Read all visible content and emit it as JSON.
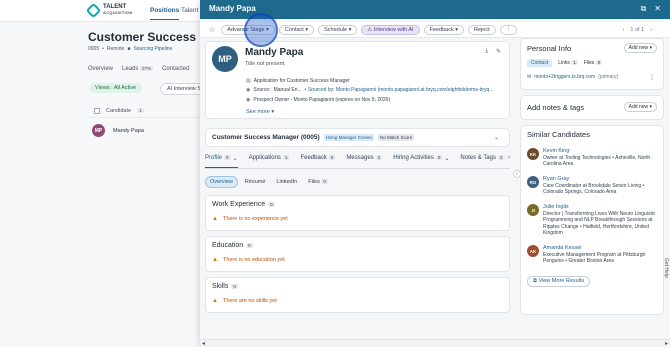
{
  "bg": {
    "logo_line1": "TALENT",
    "logo_line2": "ACQUISITION",
    "nav": [
      "Positions",
      "Talent"
    ],
    "title": "Customer Success Mc",
    "sub_id": "0005",
    "sub_sep1": "•",
    "sub_location": "Remote",
    "sub_sep2": "■",
    "sub_pipeline": "Sourcing Pipeline",
    "tabs": [
      {
        "label": "Overview",
        "count": ""
      },
      {
        "label": "Leads",
        "count": "27%"
      },
      {
        "label": "Contacted",
        "count": ""
      }
    ],
    "views_label": "Views : All Active",
    "ai_label": "AI Interview S",
    "table_header": "Candidate",
    "table_header_count": "1",
    "row_initials": "MP",
    "row_name": "Mandy Papa"
  },
  "drawer": {
    "title": "Mandy Papa",
    "head_icons": [
      "external-link",
      "close"
    ],
    "toolbar": {
      "advance_stage": "Advance Stage ▾",
      "contact": "Contact ▾",
      "schedule": "Schedule ▾",
      "interview_ai": "⚠ Interview with AI",
      "feedback": "Feedback ▾",
      "reject": "Reject",
      "more": "⋮",
      "pager": "1 of 1"
    },
    "profile": {
      "initials": "MP",
      "name": "Mandy Papa",
      "title": "Title not present.",
      "application": "Application for Customer Success Manager",
      "source_label": "Source:",
      "source_value": "Manual En...",
      "sourced_by": "• Sourced by: Monto Papagianni (monto.papagianni.at.bryq.com/eighttolderms-bryq...",
      "owner": "Prospect Owner - Monto Papagianni (expires on Nov 9, 2026)",
      "see_more": "See more ▾"
    },
    "job": {
      "title": "Customer Success Manager (0005)",
      "badge_screen": "Hiring Manager Screen",
      "badge_score": "No Match Score"
    },
    "tabs": [
      {
        "label": "Profile",
        "count": "0",
        "active": true
      },
      {
        "label": "Applications",
        "count": "1"
      },
      {
        "label": "Feedback",
        "count": "0"
      },
      {
        "label": "Messages",
        "count": "2"
      },
      {
        "label": "Hiring Activities",
        "count": "0"
      },
      {
        "label": "Notes & Tags",
        "count": "2"
      }
    ],
    "sub_tabs": [
      "Overview",
      "Résumé",
      "LinkedIn",
      "Files"
    ],
    "sub_tabs_files_count": "0",
    "sections": [
      {
        "title": "Work Experience",
        "count": "0",
        "empty": "There is no experience yet"
      },
      {
        "title": "Education",
        "count": "0",
        "empty": "There is no education yet"
      },
      {
        "title": "Skills",
        "count": "0",
        "empty": "There are no skills yet"
      }
    ]
  },
  "right": {
    "personal_info_title": "Personal Info",
    "add_new": "Add new ▾",
    "pi_tabs": [
      "Contact",
      "Links",
      "Files"
    ],
    "pi_links_count": "1",
    "pi_files_count": "0",
    "email": "monto+2triggers.tx.brq.com",
    "email_tag": "(primary)",
    "notes_title": "Add notes & tags",
    "similar_title": "Similar Candidates",
    "similar": [
      {
        "initials": "KK",
        "color": "#6b4a2f",
        "name": "Kevin King",
        "desc": "Owner at Tooling Technologies • Asheville, North Carolina Area"
      },
      {
        "initials": "RG",
        "color": "#3f5f7f",
        "name": "Ryan Gray",
        "desc": "Care Coordinator at Brookdale Senior Living • Colorado Springs, Colorado Area"
      },
      {
        "initials": "JI",
        "color": "#7a6a2a",
        "name": "Julie Inglis",
        "desc": "Director | Transforming Lives With Neuro Linguistic Programming and NLP Breakthrough Sessions at Ripples Change • Hatfield, Hertfordshire, United Kingdom"
      },
      {
        "initials": "AK",
        "color": "#9b4f2f",
        "name": "Amanda Kessel",
        "desc": "Executive Management Program at Pittsburgh Penguins • Greater Boston Area"
      }
    ],
    "view_more": "⧉ View More Results",
    "get_help": "Get Help"
  }
}
